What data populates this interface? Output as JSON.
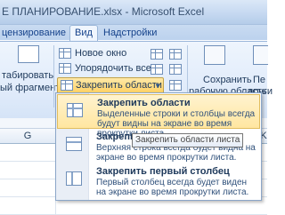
{
  "window": {
    "title": "Е ПЛАНИРОВАНИЕ.xlsx - Microsoft Excel"
  },
  "tabs": [
    {
      "label": "цензирование"
    },
    {
      "label": "Вид"
    },
    {
      "label": "Надстройки"
    }
  ],
  "ribbon": {
    "left_btn": {
      "line1": "табировать",
      "line2": "ый фрагмент"
    },
    "new_window": "Новое окно",
    "arrange_all": "Упорядочить все",
    "freeze_panes": "Закрепить области",
    "save_workspace": {
      "line1": "Сохранить",
      "line2": "рабочую область"
    },
    "switch_windows": {
      "line1": "Пе",
      "line2": "други"
    }
  },
  "grid": {
    "col_left": "G",
    "col_right": "K"
  },
  "menu": {
    "items": [
      {
        "title": "Закрепить области",
        "desc": "Выделенные строки и столбцы всегда будут видны на экране во время прокрутки листа."
      },
      {
        "title": "Закрепить",
        "desc": "Верхняя строка всегда будет видна на экране во время прокрутки листа."
      },
      {
        "title": "Закрепить первый столбец",
        "desc": "Первый столбец всегда будет виден на экране во время прокрутки листа."
      }
    ]
  },
  "tooltip": "Закрепить области листа",
  "colors": {
    "accent": "#ffd061",
    "ribbon": "#dfeafa",
    "text": "#1e395b"
  }
}
